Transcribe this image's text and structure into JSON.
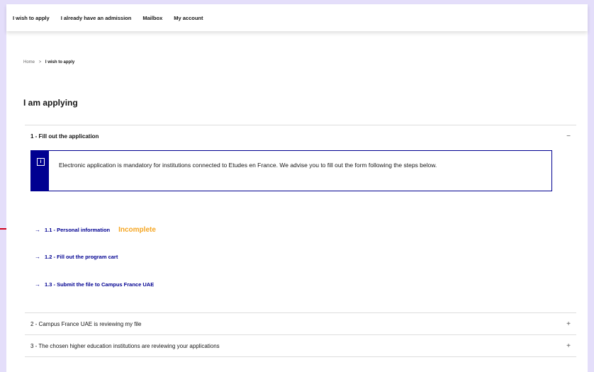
{
  "nav": {
    "items": [
      "I wish to apply",
      "I already have an admission",
      "Mailbox",
      "My account"
    ]
  },
  "breadcrumb": {
    "home": "Home",
    "separator": ">",
    "current": "I wish to apply"
  },
  "page": {
    "title": "I am applying"
  },
  "sections": [
    {
      "title": "1 - Fill out the application",
      "toggle": "−",
      "info": {
        "icon": "info-icon",
        "text": "Electronic application is mandatory for institutions connected to Etudes en France. We advise you to fill out the form following the steps below."
      },
      "steps": [
        {
          "arrow": "→",
          "label": "1.1 - Personal information",
          "status": "Incomplete"
        },
        {
          "arrow": "→",
          "label": "1.2 - Fill out the program cart"
        },
        {
          "arrow": "→",
          "label": "1.3 - Submit the file to Campus France UAE"
        }
      ]
    },
    {
      "title": "2 - Campus France UAE is reviewing my file",
      "toggle": "+"
    },
    {
      "title": "3 - The chosen higher education institutions are reviewing your applications",
      "toggle": "+"
    }
  ],
  "colors": {
    "primary": "#000091",
    "status_incomplete": "#f5a623",
    "annotation_arrow": "#d0021b",
    "outer_background": "#e4defa"
  }
}
